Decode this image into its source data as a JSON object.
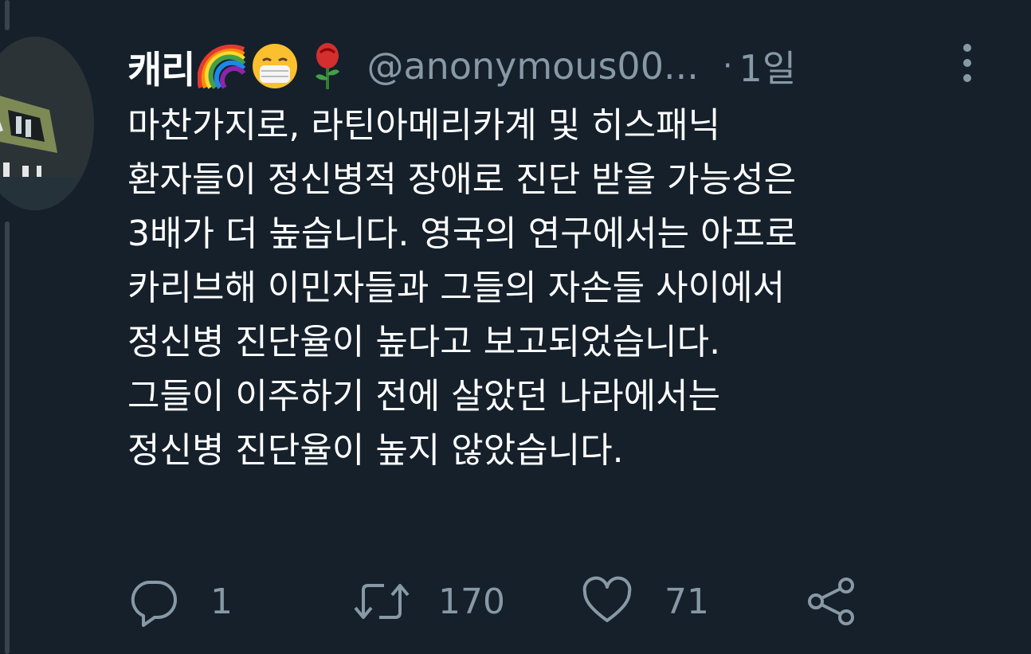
{
  "tweet": {
    "display_name": "캐리",
    "name_emojis": [
      "rainbow-emoji",
      "mask-face-emoji",
      "rose-emoji"
    ],
    "handle": "@anonymous00...",
    "separator": "·",
    "time": "1일",
    "body_lines": [
      "마찬가지로, 라틴아메리카계 및 히스패닉",
      "환자들이 정신병적 장애로 진단 받을 가능성은",
      "3배가 더 높습니다. 영국의 연구에서는 아프로",
      "카리브해 이민자들과 그들의 자손들 사이에서",
      "정신병 진단율이 높다고 보고되었습니다.",
      "그들이 이주하기 전에 살았던 나라에서는",
      "정신병 진단율이 높지 않았습니다."
    ],
    "actions": {
      "reply_count": "1",
      "retweet_count": "170",
      "like_count": "71"
    }
  },
  "colors": {
    "background": "#15202b",
    "text": "#ffffff",
    "muted": "#8899a6",
    "thread_line": "#38444d"
  },
  "icons": {
    "more": "more-vertical-icon",
    "reply": "reply-icon",
    "retweet": "retweet-icon",
    "like": "heart-icon",
    "share": "share-icon"
  }
}
